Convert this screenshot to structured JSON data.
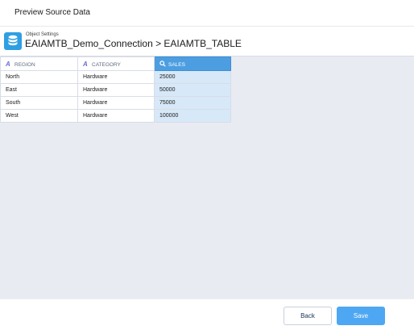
{
  "header": {
    "title": "Preview Source Data"
  },
  "object": {
    "label": "Object Settings",
    "path": "EAIAMTB_Demo_Connection > EAIAMTB_TABLE",
    "icon": "database-icon"
  },
  "table": {
    "columns": [
      {
        "label": "REGION",
        "icon": "text-type-icon"
      },
      {
        "label": "CATEGORY",
        "icon": "text-type-icon"
      },
      {
        "label": "SALES",
        "icon": "measure-icon",
        "selected": true
      }
    ],
    "rows": [
      [
        "North",
        "Hardware",
        "25000"
      ],
      [
        "East",
        "Hardware",
        "50000"
      ],
      [
        "South",
        "Hardware",
        "75000"
      ],
      [
        "West",
        "Hardware",
        "100000"
      ]
    ]
  },
  "footer": {
    "back_label": "Back",
    "save_label": "Save"
  },
  "colors": {
    "accent": "#4c9ee0",
    "selected_cell": "#d7e8f8",
    "save_button": "#4ea7f3",
    "canvas": "#e8ebf1"
  }
}
